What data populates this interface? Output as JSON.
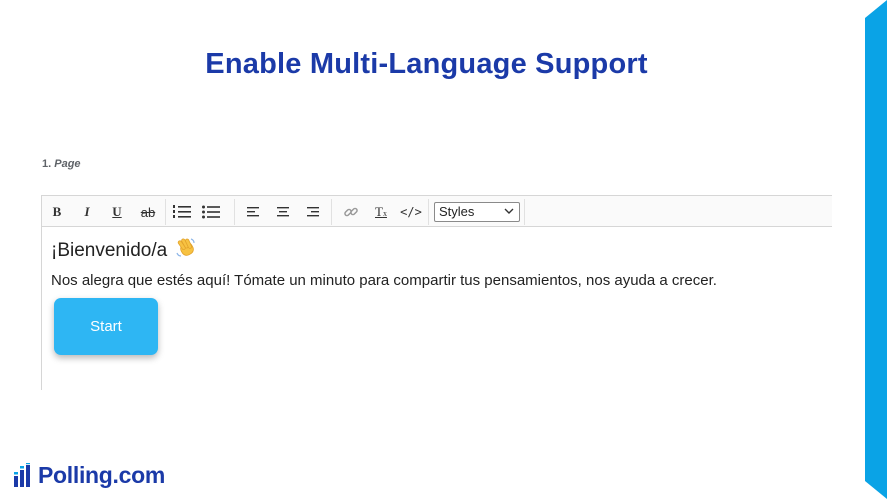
{
  "slide": {
    "title": "Enable Multi-Language Support"
  },
  "brand": {
    "name": "Polling.com",
    "color": "#1b3aa8",
    "accent": "#0aa3e6"
  },
  "page_label": {
    "number": "1.",
    "name": "Page"
  },
  "toolbar": {
    "bold": "B",
    "italic": "I",
    "underline": "U",
    "strike": "ab",
    "clear_format": "T",
    "clear_format_sub": "x",
    "code": "</>",
    "styles_select": "Styles",
    "icons": [
      "bold-icon",
      "italic-icon",
      "underline-icon",
      "strikethrough-icon",
      "ordered-list-icon",
      "bullet-list-icon",
      "align-left-icon",
      "align-center-icon",
      "align-right-icon",
      "link-icon",
      "clear-format-icon",
      "code-icon"
    ]
  },
  "editor": {
    "greeting": "¡Bienvenido/a",
    "message": "Nos alegra que estés aquí! Tómate un minuto para compartir tus pensamientos, nos ayuda a crecer.",
    "start_button": "Start",
    "button_color": "#2eb6f3"
  }
}
